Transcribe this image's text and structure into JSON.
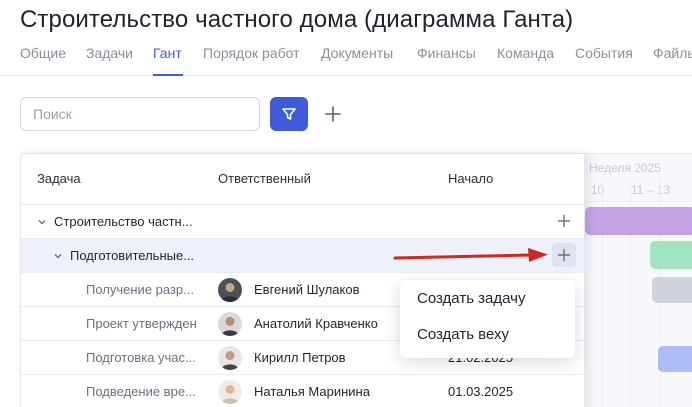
{
  "page": {
    "title": "Строительство частного дома (диаграмма Ганта)"
  },
  "tabs": [
    {
      "label": "Общие",
      "active": false
    },
    {
      "label": "Задачи",
      "active": false
    },
    {
      "label": "Гант",
      "active": true
    },
    {
      "label": "Порядок работ",
      "active": false
    },
    {
      "label": "Документы",
      "active": false
    },
    {
      "label": "Финансы",
      "active": false
    },
    {
      "label": "Команда",
      "active": false
    },
    {
      "label": "События",
      "active": false
    },
    {
      "label": "Файлы",
      "active": false
    }
  ],
  "toolbar": {
    "search_placeholder": "Поиск",
    "filter_icon": "filter-icon",
    "add_icon": "plus-icon"
  },
  "table": {
    "columns": [
      "Задача",
      "Ответственный",
      "Начало"
    ],
    "rows": [
      {
        "task": "Строительство частн...",
        "level": 0,
        "expanded": true
      },
      {
        "task": "Подготовительные...",
        "level": 1,
        "expanded": true
      },
      {
        "task": "Получение разр...",
        "level": 2,
        "person": "Евгений Шулаков",
        "start": ""
      },
      {
        "task": "Проект утвержден",
        "level": 2,
        "person": "Анатолий Кравченко",
        "start": ""
      },
      {
        "task": "Подготовка учас...",
        "level": 2,
        "person": "Кирилл Петров",
        "start": "21.02.2025"
      },
      {
        "task": "Подведение вре...",
        "level": 2,
        "person": "Наталья Маринина",
        "start": "01.03.2025"
      }
    ]
  },
  "context_menu": {
    "items": [
      "Создать задачу",
      "Создать веху"
    ]
  },
  "gantt": {
    "header_top": "Неделя 2025",
    "header_bottom": "10    11 – 13",
    "colors": {
      "purple": "#9c5bd6",
      "green": "#5fcf95",
      "gray": "#b6bcc8",
      "blue": "#6d8af2"
    }
  },
  "colors": {
    "accent": "#3f5bd9",
    "arrow": "#d2281e"
  }
}
